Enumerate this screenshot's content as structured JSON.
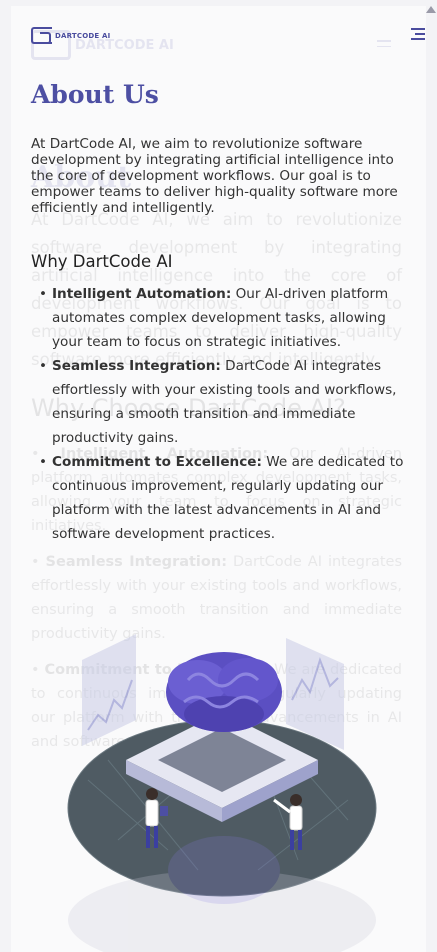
{
  "header": {
    "logo_text": "DARTCODE AI",
    "menu_icon": "hamburger-icon"
  },
  "about": {
    "title": "About Us",
    "intro": "At DartCode AI, we aim to revolutionize software development by integrating artificial intelligence into the core of development workflows. Our goal is to empower teams to deliver high-quality software more efficiently and intelligently."
  },
  "why": {
    "heading": "Why DartCode AI",
    "features": [
      {
        "title": "Intelligent Automation:",
        "text": "Our AI-driven platform automates complex development tasks, allowing your team to focus on strategic initiatives."
      },
      {
        "title": "Seamless Integration:",
        "text": "DartCode AI integrates effortlessly with your existing tools and workflows, ensuring a smooth transition and immediate productivity gains."
      },
      {
        "title": "Commitment to Excellence:",
        "text": "We are dedicated to continuous improvement, regularly updating our platform with the latest advancements in AI and software development practices."
      }
    ]
  },
  "ghost": {
    "logo_text": "DARTCODE AI",
    "title": "About",
    "intro": "At DartCode AI, we aim to revolutionize software development by integrating artificial intelligence into the core of development workflows. Our goal is to empower teams to deliver high-quality software more efficiently and intelligently.",
    "heading": "Why Choose DartCode AI?",
    "f1_title": "Intelligent Automation:",
    "f1_text": "Our AI-driven platform automates complex development tasks, allowing your team to focus on strategic initiatives.",
    "f2_title": "Seamless Integration:",
    "f2_text": "DartCode AI integrates effortlessly with your existing tools and workflows, ensuring a smooth transition and immediate productivity gains.",
    "f3_title": "Commitment to Excellence:",
    "f3_text": "We are dedicated to continuous improvement, regularly updating our platform with the latest advancements in AI and software development practices."
  },
  "colors": {
    "brand": "#4d4fa3",
    "brain": "#5b4fc2",
    "platform": "#4f5b63"
  }
}
